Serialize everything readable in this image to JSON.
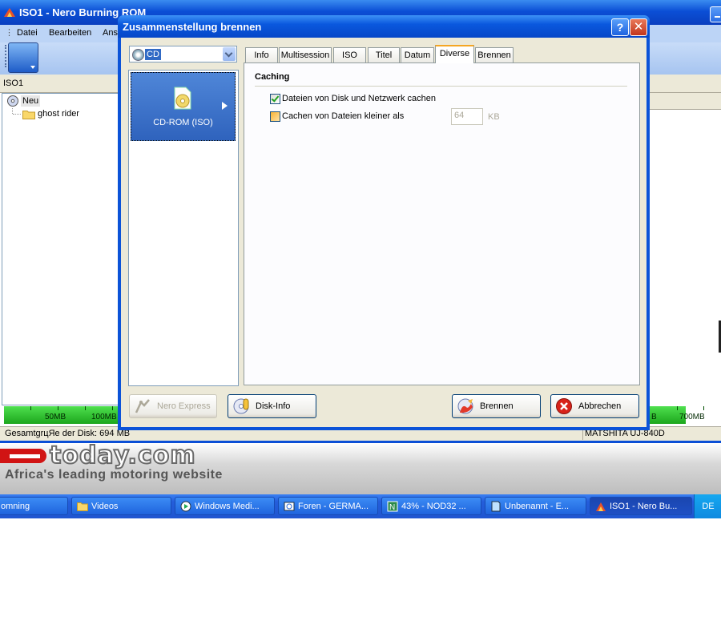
{
  "window": {
    "title": "ISO1 - Nero Burning ROM",
    "menu": [
      "Datei",
      "Bearbeiten",
      "Ans"
    ],
    "tree_header": "ISO1",
    "tree": [
      {
        "label": "Neu"
      },
      {
        "label": "ghost rider"
      }
    ],
    "capacity_ticks_left": [
      "50MB",
      "100MB"
    ],
    "capacity_ticks_right": [
      "B",
      "700MB"
    ],
    "status_left": "Gesamtgrц­Яe der Disk: 694 MB",
    "status_right": "MATSHITA UJ-840D"
  },
  "dialog": {
    "title": "Zusammenstellung brennen",
    "help_label": "?",
    "close_label": "✕",
    "disc_type": "CD",
    "list_item": "CD-ROM (ISO)",
    "tabs": [
      "Info",
      "Multisession",
      "ISO",
      "Titel",
      "Datum",
      "Diverse",
      "Brennen"
    ],
    "selected_tab": "Diverse",
    "group_title": "Caching",
    "options": [
      {
        "label": "Dateien von Disk und Netzwerk cachen",
        "checked": true
      },
      {
        "label": "Cachen von Dateien kleiner als",
        "checked": false
      }
    ],
    "cache_size_value": "64",
    "cache_size_unit": "KB",
    "buttons": {
      "nero_express": "Nero Express",
      "disk_info": "Disk-Info",
      "burn": "Brennen",
      "cancel": "Abbrechen"
    }
  },
  "banner": {
    "site": "today.com",
    "tagline": "Africa's leading motoring website"
  },
  "taskbar": {
    "items": [
      {
        "label": "omning",
        "icon": "app-icon"
      },
      {
        "label": "Videos",
        "icon": "folder-icon"
      },
      {
        "label": "Windows Medi...",
        "icon": "media-player-icon"
      },
      {
        "label": "Foren - GERMA...",
        "icon": "browser-icon"
      },
      {
        "label": "43% - NOD32 ...",
        "icon": "nod32-icon"
      },
      {
        "label": "Unbenannt - E...",
        "icon": "editor-icon"
      },
      {
        "label": "ISO1 - Nero Bu...",
        "icon": "nero-icon",
        "active": true
      }
    ],
    "language": "DE"
  }
}
